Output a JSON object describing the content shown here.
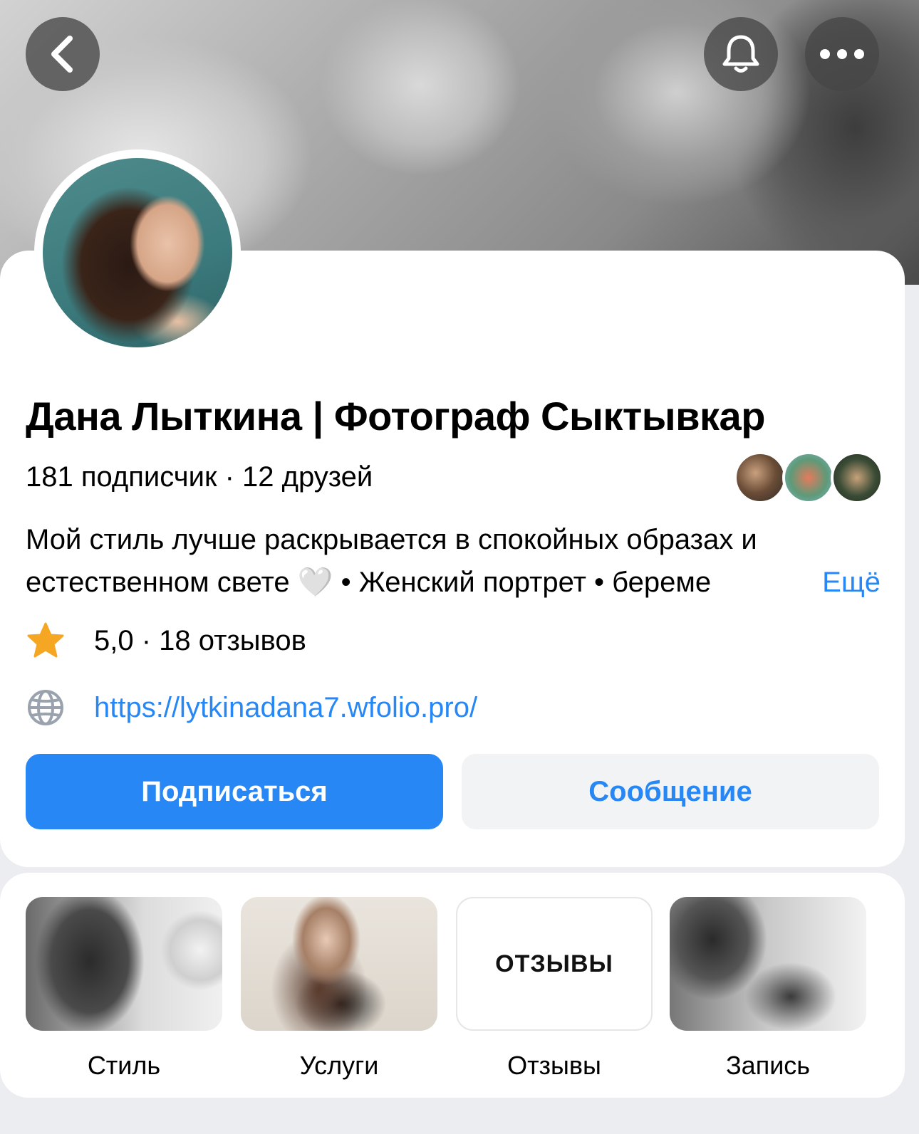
{
  "header": {
    "back_icon": "chevron-left-icon",
    "bell_icon": "bell-icon",
    "more_icon": "more-horizontal-icon"
  },
  "profile": {
    "name": "Дана Лыткина | Фотограф Сыктывкар",
    "followers_count": "181",
    "followers_label": "подписчик",
    "separator": " · ",
    "friends_count": "12",
    "friends_label": "друзей",
    "bio_line1": "Мой стиль лучше раскрывается в спокойных образах и",
    "bio_line2": "естественном свете 🤍  • Женский портрет • береме",
    "more_label": "Ещё",
    "rating_text": "5,0 · 18 отзывов",
    "website": "https://lytkinadana7.wfolio.pro/"
  },
  "actions": {
    "subscribe_label": "Подписаться",
    "message_label": "Сообщение"
  },
  "shortcuts": [
    {
      "label": "Стиль",
      "thumb_text": ""
    },
    {
      "label": "Услуги",
      "thumb_text": ""
    },
    {
      "label": "Отзывы",
      "thumb_text": "ОТЗЫВЫ"
    },
    {
      "label": "Запись",
      "thumb_text": ""
    }
  ],
  "colors": {
    "accent": "#2787f5",
    "star": "#f5a623",
    "background": "#ebedf0"
  }
}
